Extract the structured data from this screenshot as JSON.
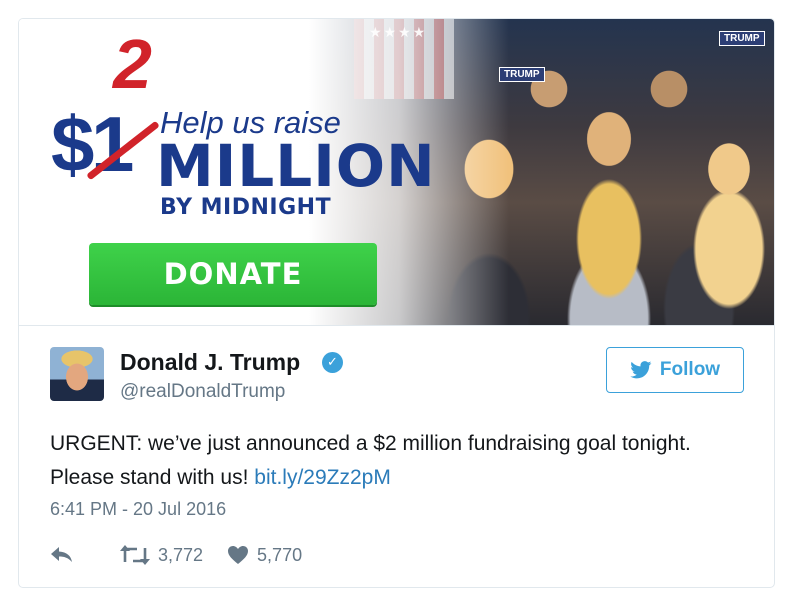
{
  "banner": {
    "superscript": "2",
    "dollar_symbol": "$",
    "strikethrough_digit": "1",
    "help_text": "Help us raise",
    "million_text": "MILLION",
    "midnight_text": "BY MIDNIGHT",
    "donate_label": "DONATE",
    "sign_text_top": "TRUMP",
    "sign_text_mid": "TRUMP"
  },
  "tweet": {
    "author_name": "Donald J. Trump",
    "handle": "@realDonaldTrump",
    "follow_label": "Follow",
    "text_main": "URGENT: we’ve just announced a $2 million fundraising goal tonight. Please stand with us! ",
    "link_text": "bit.ly/29Zz2pM",
    "timestamp": "6:41 PM - 20 Jul 2016",
    "retweets": "3,772",
    "likes": "5,770"
  },
  "colors": {
    "banner_blue": "#1b3a8b",
    "banner_red": "#d1232a",
    "donate_green": "#2bb537",
    "twitter_blue": "#3ba1da",
    "link_blue": "#2b7bb9",
    "text_gray": "#657786"
  },
  "icons": {
    "verified": "verified-badge-icon",
    "follow": "twitter-bird-icon",
    "reply": "reply-icon",
    "retweet": "retweet-icon",
    "like": "heart-icon"
  }
}
